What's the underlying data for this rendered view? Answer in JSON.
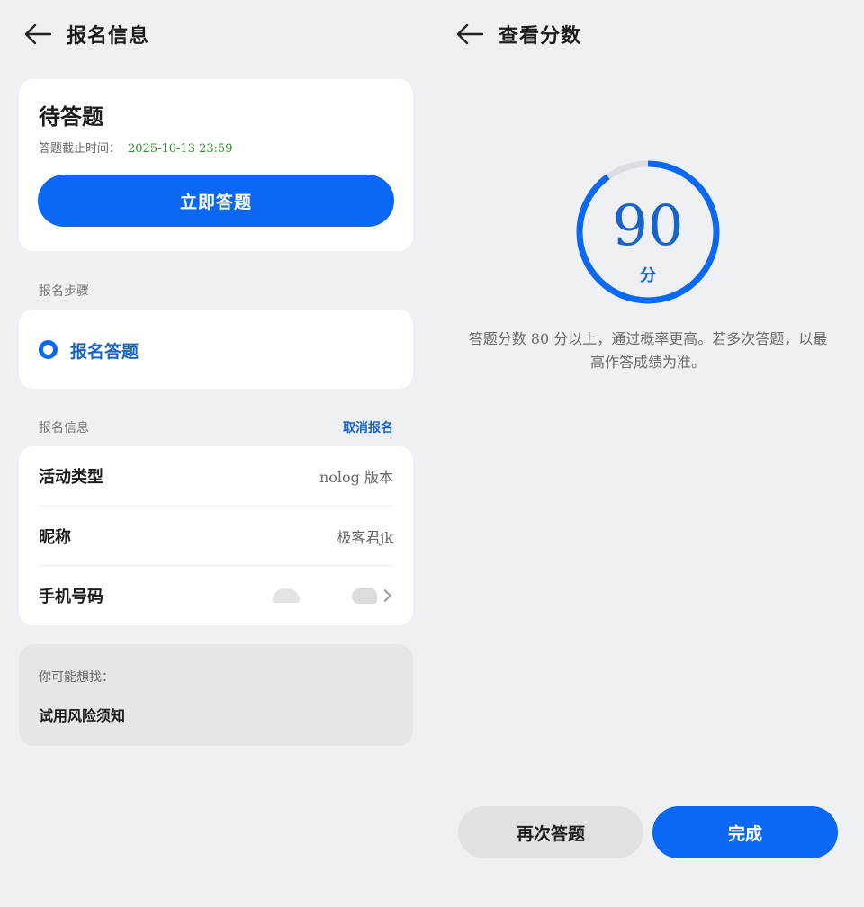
{
  "left": {
    "title": "报名信息",
    "pending": {
      "heading": "待答题",
      "deadline_label": "答题截止时间：",
      "deadline_value": "2025-10-13  23:59",
      "answer_button": "立即答题"
    },
    "steps_label": "报名步骤",
    "steps": [
      {
        "label": "报名答题"
      }
    ],
    "info_label": "报名信息",
    "cancel_label": "取消报名",
    "info_rows": [
      {
        "key": "活动类型",
        "value": "nolog 版本"
      },
      {
        "key": "昵称",
        "value": "极客君jk"
      },
      {
        "key": "手机号码",
        "value": ""
      }
    ],
    "suggest": {
      "hint": "你可能想找：",
      "link": "试用风险须知"
    }
  },
  "right": {
    "title": "查看分数",
    "score": "90",
    "score_unit": "分",
    "score_fraction": 0.9,
    "note": "答题分数 80 分以上，通过概率更高。若多次答题，以最高作答成绩为准。",
    "retry_button": "再次答题",
    "done_button": "完成"
  },
  "colors": {
    "accent": "#0a68f5",
    "link": "#1763c9",
    "deadline": "#2e8b2e",
    "background": "#eef0f3"
  },
  "icons": [
    "back-arrow-icon",
    "radio-selected-icon",
    "chevron-right-icon"
  ]
}
